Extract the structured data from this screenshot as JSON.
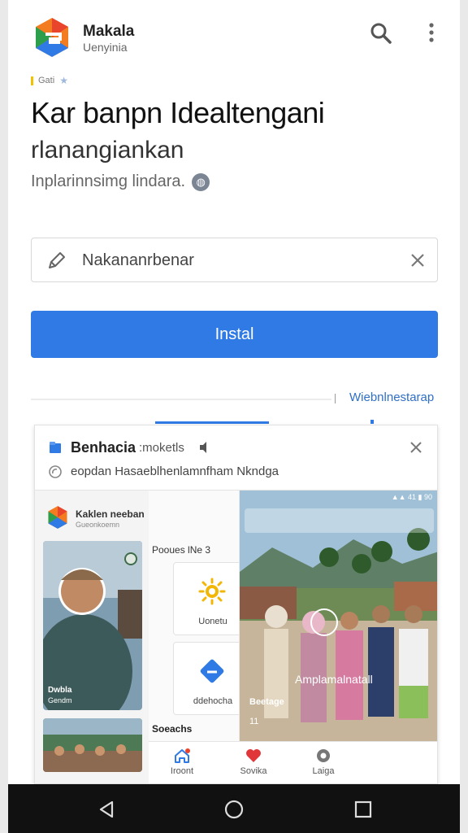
{
  "header": {
    "app_name": "Makala",
    "app_subtitle": "Uenyinia",
    "tag": "Gati"
  },
  "hero": {
    "title": "Kar banpn Idealtengani",
    "subtitle": "rlanangiankan",
    "description": "Inplarinnsimg lindara."
  },
  "search": {
    "value": "Nakananrbenar"
  },
  "install_button": "Instal",
  "link": "Wiebnlnestarap",
  "card": {
    "title": "Benhacia",
    "title_extra": ":moketls",
    "subtitle": "eopdan Hasaeblhenlamnfham Nkndga",
    "mini_app": {
      "title": "Kaklen neeban",
      "subtitle": "Gueonkoemn"
    },
    "photo1_label": "Dwbla",
    "photo1_sub": "Gendm",
    "mid_heading": "Pooues lNe 3",
    "features": [
      {
        "icon": "sun-icon",
        "label": "Uonetu"
      },
      {
        "icon": "chat-icon",
        "label": "ddehocha"
      }
    ],
    "mid_footer": "Soeachs",
    "status": "▲▲ 41 ▮ 90",
    "photo_caption": "Amplamalnatall",
    "photo_label": "Beetage",
    "photo_count": "11",
    "nav": [
      {
        "icon": "home-icon",
        "label": "Iroont"
      },
      {
        "icon": "heart-icon",
        "label": "Sovika"
      },
      {
        "icon": "circle-icon",
        "label": "Laiga"
      }
    ]
  },
  "colors": {
    "accent": "#2f7ae5",
    "link": "#2f6fc8"
  }
}
